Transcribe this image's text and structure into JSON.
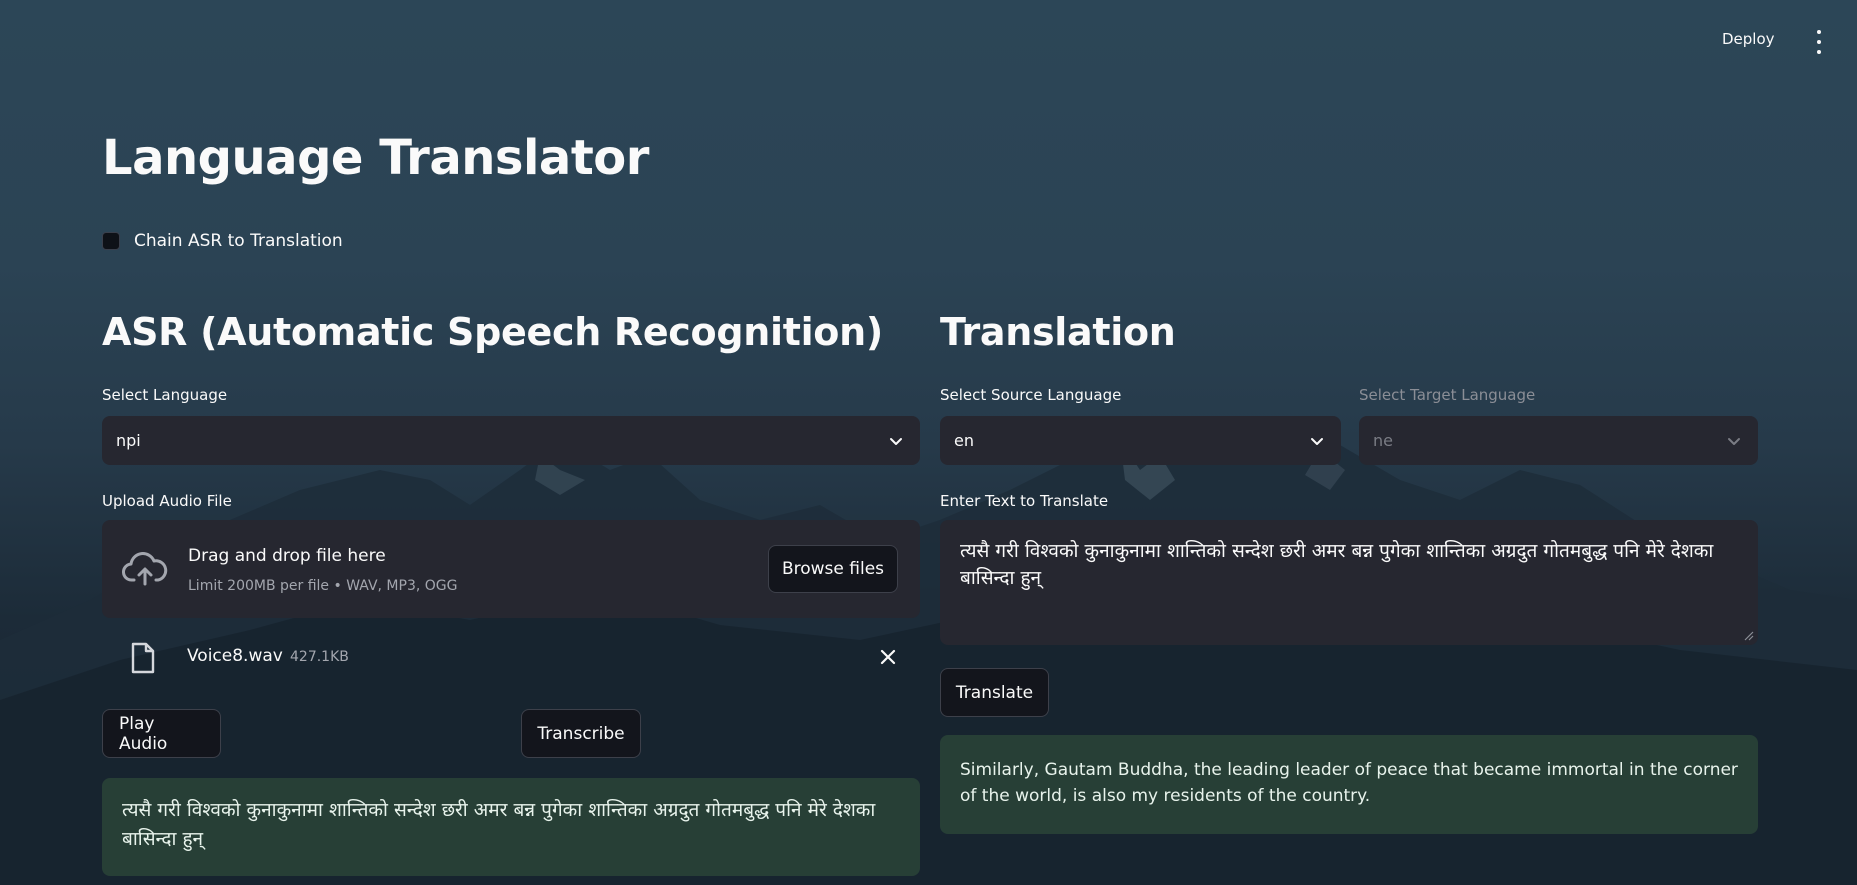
{
  "header": {
    "deploy_label": "Deploy",
    "menu_icon": "kebab-menu-icon"
  },
  "page": {
    "title": "Language Translator",
    "chain_checkbox": {
      "label": "Chain ASR to Translation",
      "checked": false
    }
  },
  "asr": {
    "title": "ASR (Automatic Speech Recognition)",
    "language_label": "Select Language",
    "language_value": "npi",
    "upload_label": "Upload Audio File",
    "uploader": {
      "title": "Drag and drop file here",
      "subtitle": "Limit 200MB per file • WAV, MP3, OGG",
      "browse_label": "Browse files",
      "icon": "cloud-upload-icon"
    },
    "file": {
      "name": "Voice8.wav",
      "size": "427.1KB",
      "icon": "file-icon"
    },
    "play_label": "Play Audio",
    "transcribe_label": "Transcribe",
    "result": "त्यसै गरी विश्वको कुनाकुनामा शान्तिको सन्देश छरी अमर बन्न पुगेका शान्तिका अग्रदुत गोतमबुद्ध पनि मेरे देशका बासिन्दा हुन्"
  },
  "translation": {
    "title": "Translation",
    "source_label": "Select Source Language",
    "source_value": "en",
    "target_label": "Select Target Language",
    "target_value": "ne",
    "input_label": "Enter Text to Translate",
    "input_value": "त्यसै गरी विश्वको कुनाकुनामा शान्तिको सन्देश छरी अमर बन्न पुगेका शान्तिका अग्रदुत गोतमबुद्ध पनि मेरे देशका बासिन्दा हुन्",
    "translate_label": "Translate",
    "result": "Similarly, Gautam Buddha, the leading leader of peace that became immortal in the corner of the world, is also my residents of the country."
  },
  "colors": {
    "background_top": "#2c4657",
    "background_bottom": "#15222c",
    "widget_bg": "#262730",
    "success_bg": "#273f36"
  }
}
